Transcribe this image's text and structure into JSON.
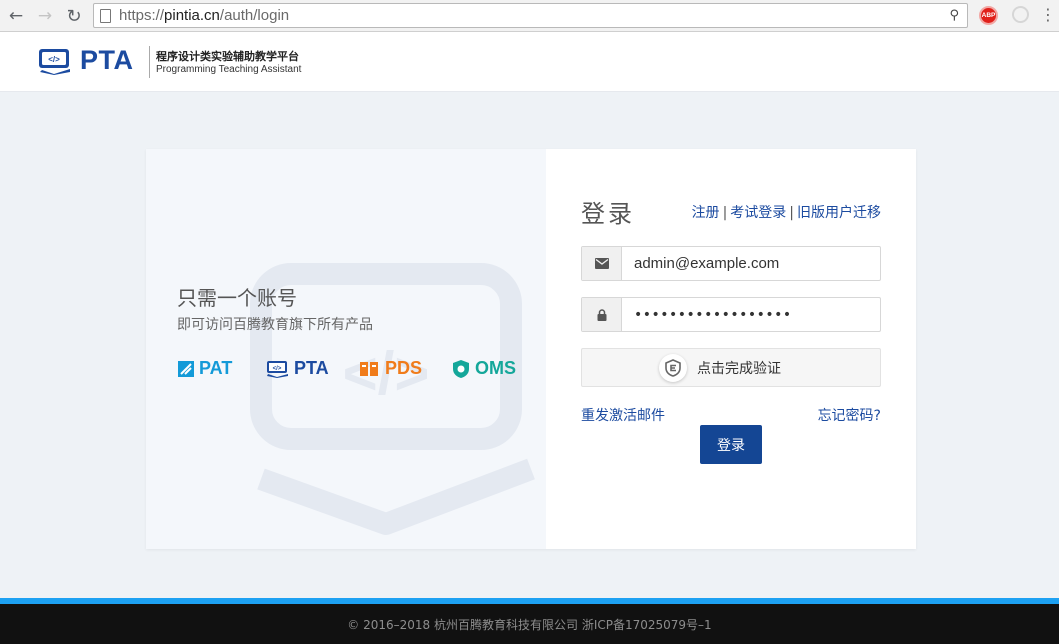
{
  "browser": {
    "url_scheme": "https://",
    "url_host": "pintia.cn",
    "url_path": "/auth/login",
    "abp_label": "ABP"
  },
  "header": {
    "logo_text": "PTA",
    "logo_cn": "程序设计类实验辅助教学平台",
    "logo_en": "Programming Teaching Assistant"
  },
  "promo": {
    "title": "只需一个账号",
    "subtitle": "即可访问百腾教育旗下所有产品",
    "brands": [
      "PAT",
      "PTA",
      "PDS",
      "OMS"
    ]
  },
  "login": {
    "title": "登录",
    "links": [
      "注册",
      "考试登录",
      "旧版用户迁移"
    ],
    "link_separator": "|",
    "email_value": "admin@example.com",
    "password_mask": "••••••••••••••••••",
    "captcha_text": "点击完成验证",
    "resend_link": "重发激活邮件",
    "forgot_link": "忘记密码?",
    "submit_label": "登录"
  },
  "footer": {
    "text": "© 2016–2018 杭州百腾教育科技有限公司 浙ICP备17025079号–1"
  },
  "colors": {
    "brand_blue": "#1c4ba0",
    "button_blue": "#144694",
    "footer_accent": "#1da1f2"
  }
}
